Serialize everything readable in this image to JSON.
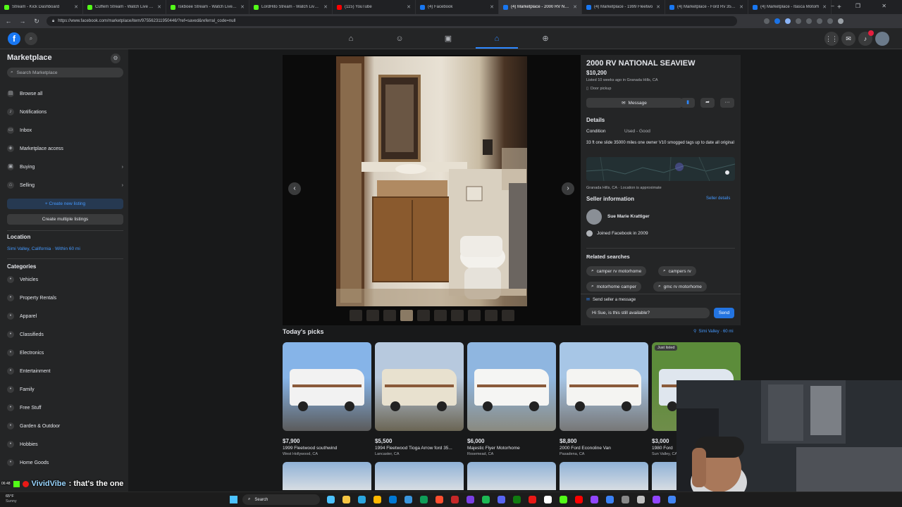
{
  "browser": {
    "tabs": [
      {
        "title": "Stream - Kick Dashboard",
        "color": "#53fc18"
      },
      {
        "title": "Cuffem Stream - Watch Live on K",
        "color": "#53fc18"
      },
      {
        "title": "Iskboee Stream - Watch Live on K",
        "color": "#53fc18"
      },
      {
        "title": "LordHito Stream - Watch Live on",
        "color": "#53fc18"
      },
      {
        "title": "(115) YouTube",
        "color": "#ff0000"
      },
      {
        "title": "(4) Facebook",
        "color": "#1877f2"
      },
      {
        "title": "(4) Marketplace - 2000 RV NATI",
        "color": "#1877f2"
      },
      {
        "title": "(4) Marketplace - 1999 Fleetwo",
        "color": "#1877f2"
      },
      {
        "title": "(4) Marketplace - Ford Rv 350 E",
        "color": "#1877f2"
      },
      {
        "title": "(4) Marketplace - Itasca Motorh",
        "color": "#1877f2"
      }
    ],
    "url": "https://www.facebook.com/marketplace/item/975562311950446/?ref=saved&referral_code=null"
  },
  "sidebar": {
    "title": "Marketplace",
    "search_placeholder": "Search Marketplace",
    "items": [
      {
        "label": "Browse all",
        "icon": "store-icon"
      },
      {
        "label": "Notifications",
        "icon": "bell-icon"
      },
      {
        "label": "Inbox",
        "icon": "inbox-icon"
      },
      {
        "label": "Marketplace access",
        "icon": "shield-icon"
      },
      {
        "label": "Buying",
        "icon": "bag-icon"
      },
      {
        "label": "Selling",
        "icon": "tag-icon"
      }
    ],
    "create_listing": "+ Create new listing",
    "create_multiple": "Create multiple listings",
    "location_heading": "Location",
    "location_value": "Simi Valley, California · Within 60 mi",
    "categories_heading": "Categories",
    "categories": [
      "Vehicles",
      "Property Rentals",
      "Apparel",
      "Classifieds",
      "Electronics",
      "Entertainment",
      "Family",
      "Free Stuff",
      "Garden & Outdoor",
      "Hobbies",
      "Home Goods"
    ]
  },
  "listing": {
    "title": "2000 RV NATIONAL SEAVIEW",
    "price": "$10,200",
    "listed": "Listed 10 weeks ago in Granada Hills, CA",
    "pickup": "Door pickup",
    "message_btn": "Message",
    "details_heading": "Details",
    "condition_label": "Condition",
    "condition_value": "Used - Good",
    "description": "33 ft one slide  35000 miles one owner  V10 smogged tags up to date all original",
    "map_caption": "Granada Hills, CA · Location is approximate",
    "seller_heading": "Seller information",
    "seller_details": "Seller details",
    "seller_name": "Sue Marie Krattiger",
    "joined": "Joined Facebook in 2009",
    "related_heading": "Related searches",
    "related": [
      "camper rv motorhome",
      "campers rv",
      "motorhome camper",
      "gmc rv motorhome"
    ],
    "send_msg_label": "Send seller a message",
    "send_msg_text": "Hi Sue, is this still available?",
    "send_btn": "Send"
  },
  "picks": {
    "heading": "Today's picks",
    "location": "Simi Valley · 60 mi",
    "items": [
      {
        "price": "$7,900",
        "title": "1999 Fleetwood southwind",
        "loc": "West Hollywood, CA",
        "badge": ""
      },
      {
        "price": "$5,500",
        "title": "1994 Fleetwood Tioga Arrow ford 35...",
        "loc": "Lancaster, CA",
        "badge": ""
      },
      {
        "price": "$6,000",
        "title": "Majestic Flyer Motorhome",
        "loc": "Rosemead, CA",
        "badge": ""
      },
      {
        "price": "$8,800",
        "title": "2000 Ford Econoline Van",
        "loc": "Pasadena, CA",
        "badge": ""
      },
      {
        "price": "$3,000",
        "title": "1980 Ford",
        "loc": "Sun Valley, CA",
        "badge": "Just listed"
      }
    ]
  },
  "overlay": {
    "chat_user": "VividVibe",
    "chat_text": ": that's the one",
    "clock": "06:48"
  },
  "taskbar": {
    "weather": "65°F",
    "weather_sub": "Sunny",
    "search": "Search"
  }
}
